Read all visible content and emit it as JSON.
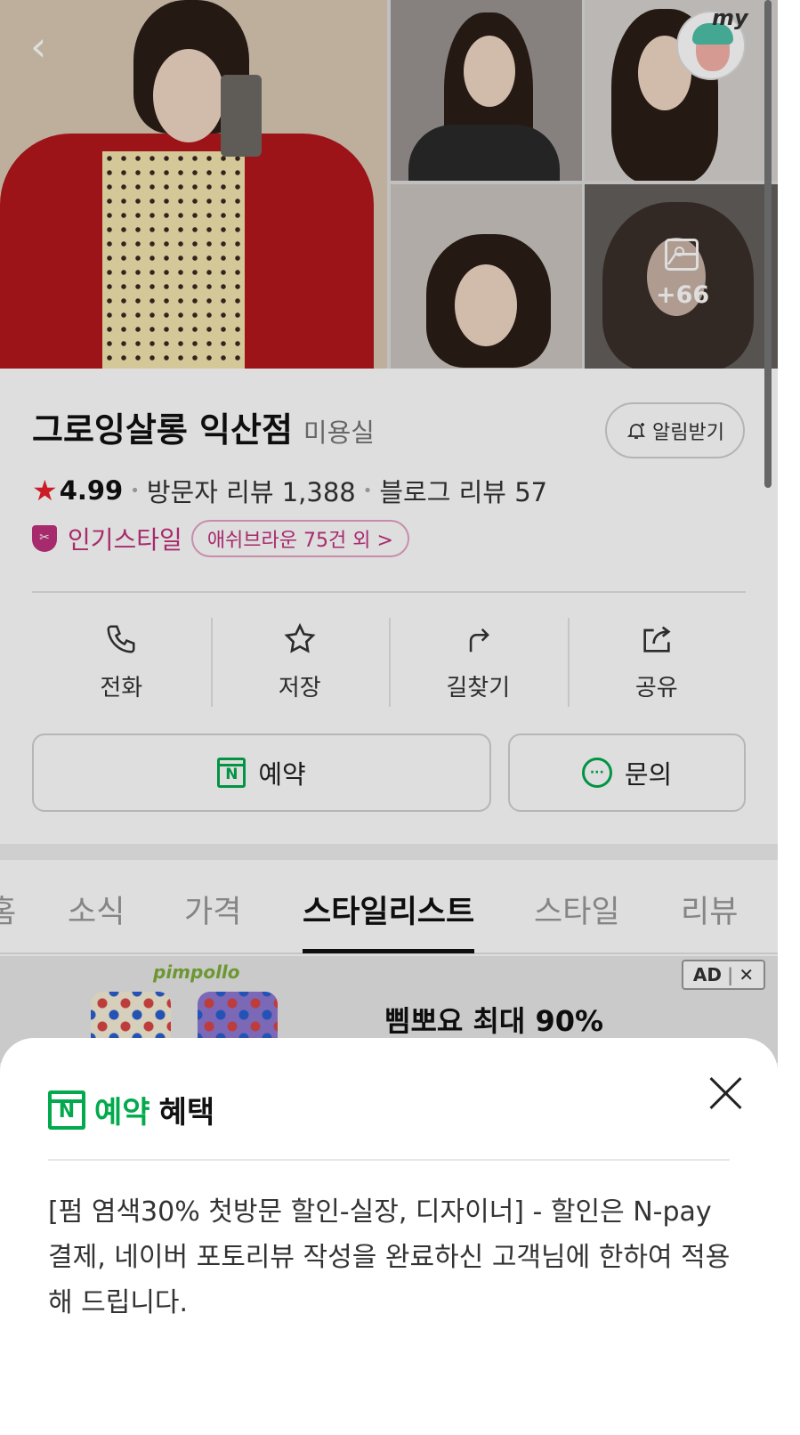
{
  "header": {
    "back_icon": "chevron-left-icon",
    "my_label": "my"
  },
  "photos": {
    "more_count": "+66",
    "gallery_icon": "image-icon"
  },
  "shop": {
    "name": "그로잉살롱 익산점",
    "category": "미용실",
    "notify_label": "알림받기",
    "rating": "4.99",
    "visitor_reviews": "방문자 리뷰 1,388",
    "blog_reviews": "블로그 리뷰 57",
    "popular_label": "인기스타일",
    "popular_chip": "애쉬브라운 75건 외 >"
  },
  "actions": [
    {
      "label": "전화",
      "icon": "phone-icon"
    },
    {
      "label": "저장",
      "icon": "star-icon"
    },
    {
      "label": "길찾기",
      "icon": "directions-icon"
    },
    {
      "label": "공유",
      "icon": "share-icon"
    }
  ],
  "cta": {
    "reserve": "예약",
    "inquiry": "문의"
  },
  "tabs": [
    "홈",
    "소식",
    "가격",
    "스타일리스트",
    "스타일",
    "리뷰"
  ],
  "active_tab": "스타일리스트",
  "ad": {
    "brand": "pimpollo",
    "text": "삠뽀요 최대 90%",
    "badge": "AD",
    "close": "✕"
  },
  "sheet": {
    "title_green": "예약",
    "title_black": "혜택",
    "body": "[펌 염색30% 첫방문 할인-실장, 디자이너] - 할인은 N-pay 결제, 네이버 포토리뷰 작성을 완료하신 고객님에 한하여 적용해 드립니다."
  },
  "colors": {
    "brand_green": "#03a94d",
    "accent_pink": "#c0317d",
    "star_red": "#e8222e"
  }
}
